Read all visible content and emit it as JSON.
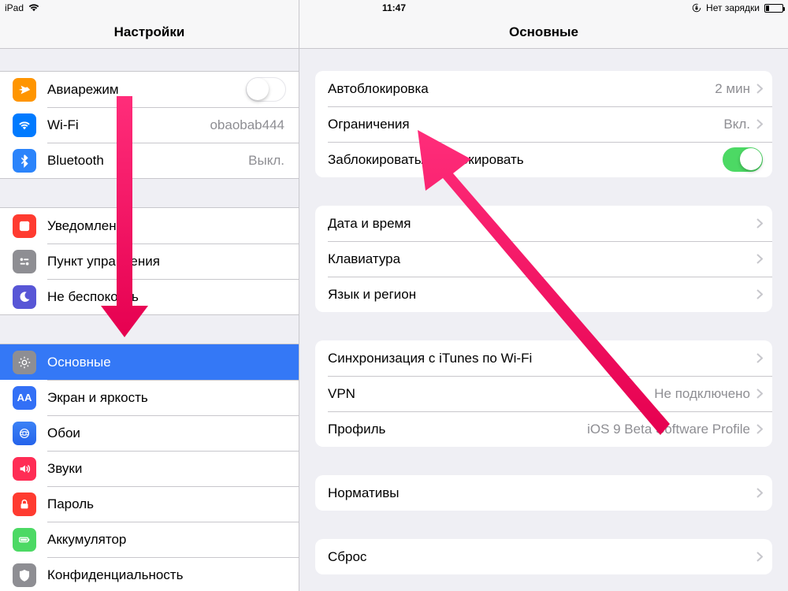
{
  "status": {
    "device": "iPad",
    "time": "11:47",
    "charging": "Нет зарядки"
  },
  "sidebar": {
    "title": "Настройки",
    "items": {
      "airplane": {
        "label": "Авиарежим"
      },
      "wifi": {
        "label": "Wi-Fi",
        "value": "obaobab444"
      },
      "bluetooth": {
        "label": "Bluetooth",
        "value": "Выкл."
      },
      "notif": {
        "label": "Уведомления"
      },
      "control": {
        "label": "Пункт управления"
      },
      "dnd": {
        "label": "Не беспокоить"
      },
      "general": {
        "label": "Основные"
      },
      "display": {
        "label": "Экран и яркость"
      },
      "wallpaper": {
        "label": "Обои"
      },
      "sounds": {
        "label": "Звуки"
      },
      "passcode": {
        "label": "Пароль"
      },
      "battery": {
        "label": "Аккумулятор"
      },
      "privacy": {
        "label": "Конфиденциальность"
      }
    }
  },
  "main": {
    "title": "Основные",
    "autolock": {
      "label": "Автоблокировка",
      "value": "2 мин"
    },
    "restrict": {
      "label": "Ограничения",
      "value": "Вкл."
    },
    "lockunlock": {
      "label": "Заблокировать/разблокировать"
    },
    "datetime": {
      "label": "Дата и время"
    },
    "keyboard": {
      "label": "Клавиатура"
    },
    "langregion": {
      "label": "Язык и регион"
    },
    "itunes": {
      "label": "Синхронизация с iTunes по Wi-Fi"
    },
    "vpn": {
      "label": "VPN",
      "value": "Не подключено"
    },
    "profile": {
      "label": "Профиль",
      "value": "iOS 9 Beta Software Profile"
    },
    "legal": {
      "label": "Нормативы"
    },
    "reset": {
      "label": "Сброс"
    }
  }
}
